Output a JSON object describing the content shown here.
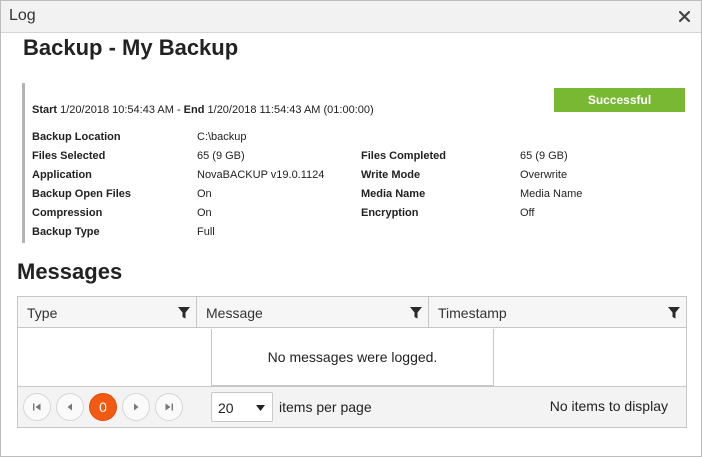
{
  "window": {
    "title": "Log"
  },
  "summary": {
    "heading": "Backup - My Backup",
    "start_label": "Start",
    "start_value": "1/20/2018 10:54:43 AM",
    "end_sep": " - ",
    "end_label": "End",
    "end_value": "1/20/2018 11:54:43 AM (01:00:00)",
    "status": "Successful",
    "status_color": "#78b833",
    "left": [
      {
        "label": "Backup Location",
        "value": "C:\\backup"
      },
      {
        "label": "Files Selected",
        "value": "65  (9 GB)"
      },
      {
        "label": "Application",
        "value": "NovaBACKUP v19.0.1124"
      },
      {
        "label": "Backup Open Files",
        "value": "On"
      },
      {
        "label": "Compression",
        "value": "On"
      },
      {
        "label": "Backup Type",
        "value": "Full"
      }
    ],
    "right": [
      {
        "label": "Files Completed",
        "value": "65  (9 GB)"
      },
      {
        "label": "Write Mode",
        "value": "Overwrite"
      },
      {
        "label": "Media Name",
        "value": "Media Name"
      },
      {
        "label": "Encryption",
        "value": "Off"
      }
    ]
  },
  "messages": {
    "heading": "Messages",
    "columns": [
      "Type",
      "Message",
      "Timestamp"
    ],
    "empty_text": "No messages were logged.",
    "pager": {
      "current_page": "0",
      "page_size": "20",
      "per_page_label": "items per page",
      "status": "No items to display",
      "accent_color": "#f05a13"
    }
  }
}
